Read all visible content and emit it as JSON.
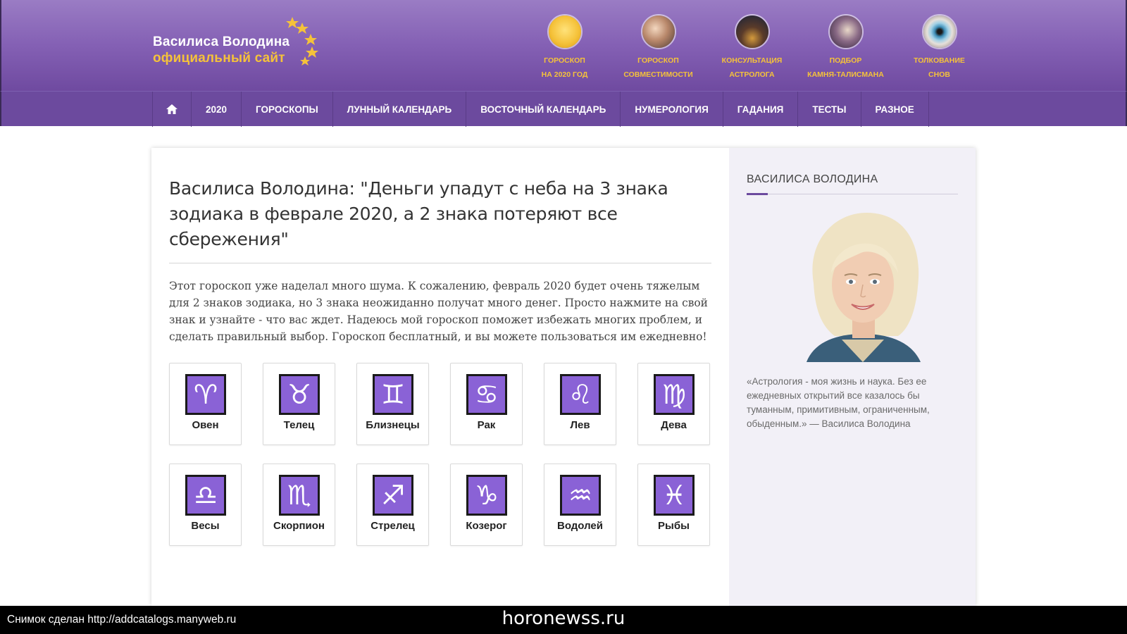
{
  "header": {
    "logo_line1": "Василиса Володина",
    "logo_line2": "официальный сайт",
    "services": [
      {
        "line1": "Гороскоп",
        "line2": "на 2020 год",
        "icon": "gold-horse-icon"
      },
      {
        "line1": "Гороскоп",
        "line2": "совместимости",
        "icon": "couple-photo-icon"
      },
      {
        "line1": "Консультация",
        "line2": "астролога",
        "icon": "city-night-icon"
      },
      {
        "line1": "Подбор",
        "line2": "камня-талисмана",
        "icon": "gem-stones-icon"
      },
      {
        "line1": "Толкование",
        "line2": "снов",
        "icon": "eye-icon"
      }
    ]
  },
  "nav": {
    "home_icon": "home-icon",
    "items": [
      "2020",
      "Гороскопы",
      "Лунный календарь",
      "Восточный календарь",
      "Нумерология",
      "Гадания",
      "Тесты",
      "Разное"
    ]
  },
  "article": {
    "title": "Василиса Володина: \"Деньги упадут с неба на 3 знака зодиака в феврале 2020, а 2 знака потеряют все сбережения\"",
    "intro": "Этот гороскоп уже наделал много шума. К сожалению, февраль 2020 будет очень тяжелым для 2 знаков зодиака, но 3 знака неожиданно получат много денег. Просто нажмите на свой знак и узнайте - что вас ждет. Надеюсь мой гороскоп поможет избежать многих проблем, и сделать правильный выбор. Гороскоп бесплатный, и вы можете пользоваться им ежедневно!",
    "zodiac": [
      {
        "name": "Овен",
        "symbol": "♈",
        "icon": "aries-icon"
      },
      {
        "name": "Телец",
        "symbol": "♉",
        "icon": "taurus-icon"
      },
      {
        "name": "Близнецы",
        "symbol": "♊",
        "icon": "gemini-icon"
      },
      {
        "name": "Рак",
        "symbol": "♋",
        "icon": "cancer-icon"
      },
      {
        "name": "Лев",
        "symbol": "♌",
        "icon": "leo-icon"
      },
      {
        "name": "Дева",
        "symbol": "♍",
        "icon": "virgo-icon"
      },
      {
        "name": "Весы",
        "symbol": "♎",
        "icon": "libra-icon"
      },
      {
        "name": "Скорпион",
        "symbol": "♏",
        "icon": "scorpio-icon"
      },
      {
        "name": "Стрелец",
        "symbol": "♐",
        "icon": "sagittarius-icon"
      },
      {
        "name": "Козерог",
        "symbol": "♑",
        "icon": "capricorn-icon"
      },
      {
        "name": "Водолей",
        "symbol": "♒",
        "icon": "aquarius-icon"
      },
      {
        "name": "Рыбы",
        "symbol": "♓",
        "icon": "pisces-icon"
      }
    ]
  },
  "sidebar": {
    "title": "Василиса Володина",
    "quote": "«Астрология - моя жизнь и наука. Без ее ежедневных открытий все казалось бы туманным, примитивным, ограниченным, обыденным.» — Василиса Володина"
  },
  "footer": {
    "left": "Снимок сделан http://addcatalogs.manyweb.ru",
    "center": "horonewss.ru"
  },
  "colors": {
    "header_purple": "#8460b4",
    "nav_purple": "#6c4a9e",
    "accent_gold": "#f5c23a",
    "zodiac_tile": "#8a62d6"
  }
}
